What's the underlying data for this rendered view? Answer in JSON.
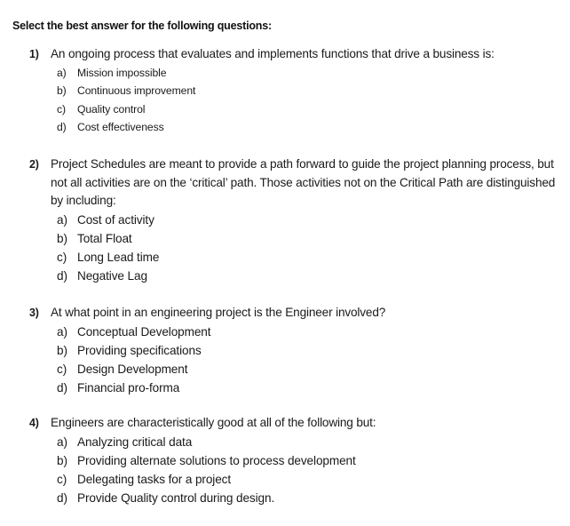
{
  "document": {
    "heading": "Select the best answer for the following questions:",
    "questions": [
      {
        "number": "1)",
        "text": "An ongoing process that evaluates and implements functions that drive a business is:",
        "options": [
          {
            "letter": "a)",
            "text": "Mission impossible"
          },
          {
            "letter": "b)",
            "text": "Continuous improvement"
          },
          {
            "letter": "c)",
            "text": "Quality control"
          },
          {
            "letter": "d)",
            "text": "Cost effectiveness"
          }
        ]
      },
      {
        "number": "2)",
        "text": "Project Schedules are meant to provide a path forward to guide the project planning process, but not all activities are on the ‘critical’ path. Those activities not on the Critical Path are distinguished by including:",
        "options": [
          {
            "letter": "a)",
            "text": "Cost of activity"
          },
          {
            "letter": "b)",
            "text": "Total Float"
          },
          {
            "letter": "c)",
            "text": "Long Lead time"
          },
          {
            "letter": "d)",
            "text": "Negative Lag"
          }
        ]
      },
      {
        "number": "3)",
        "text": "At what point in an engineering project is the Engineer involved?",
        "options": [
          {
            "letter": "a)",
            "text": "Conceptual Development"
          },
          {
            "letter": "b)",
            "text": "Providing specifications"
          },
          {
            "letter": "c)",
            "text": "Design Development"
          },
          {
            "letter": "d)",
            "text": "Financial pro-forma"
          }
        ]
      },
      {
        "number": "4)",
        "text": "Engineers are characteristically good at all of the following but:",
        "options": [
          {
            "letter": "a)",
            "text": "Analyzing critical data"
          },
          {
            "letter": "b)",
            "text": "Providing alternate solutions to process development"
          },
          {
            "letter": "c)",
            "text": "Delegating tasks for a project"
          },
          {
            "letter": "d)",
            "text": "Provide Quality control during design."
          }
        ]
      }
    ]
  }
}
